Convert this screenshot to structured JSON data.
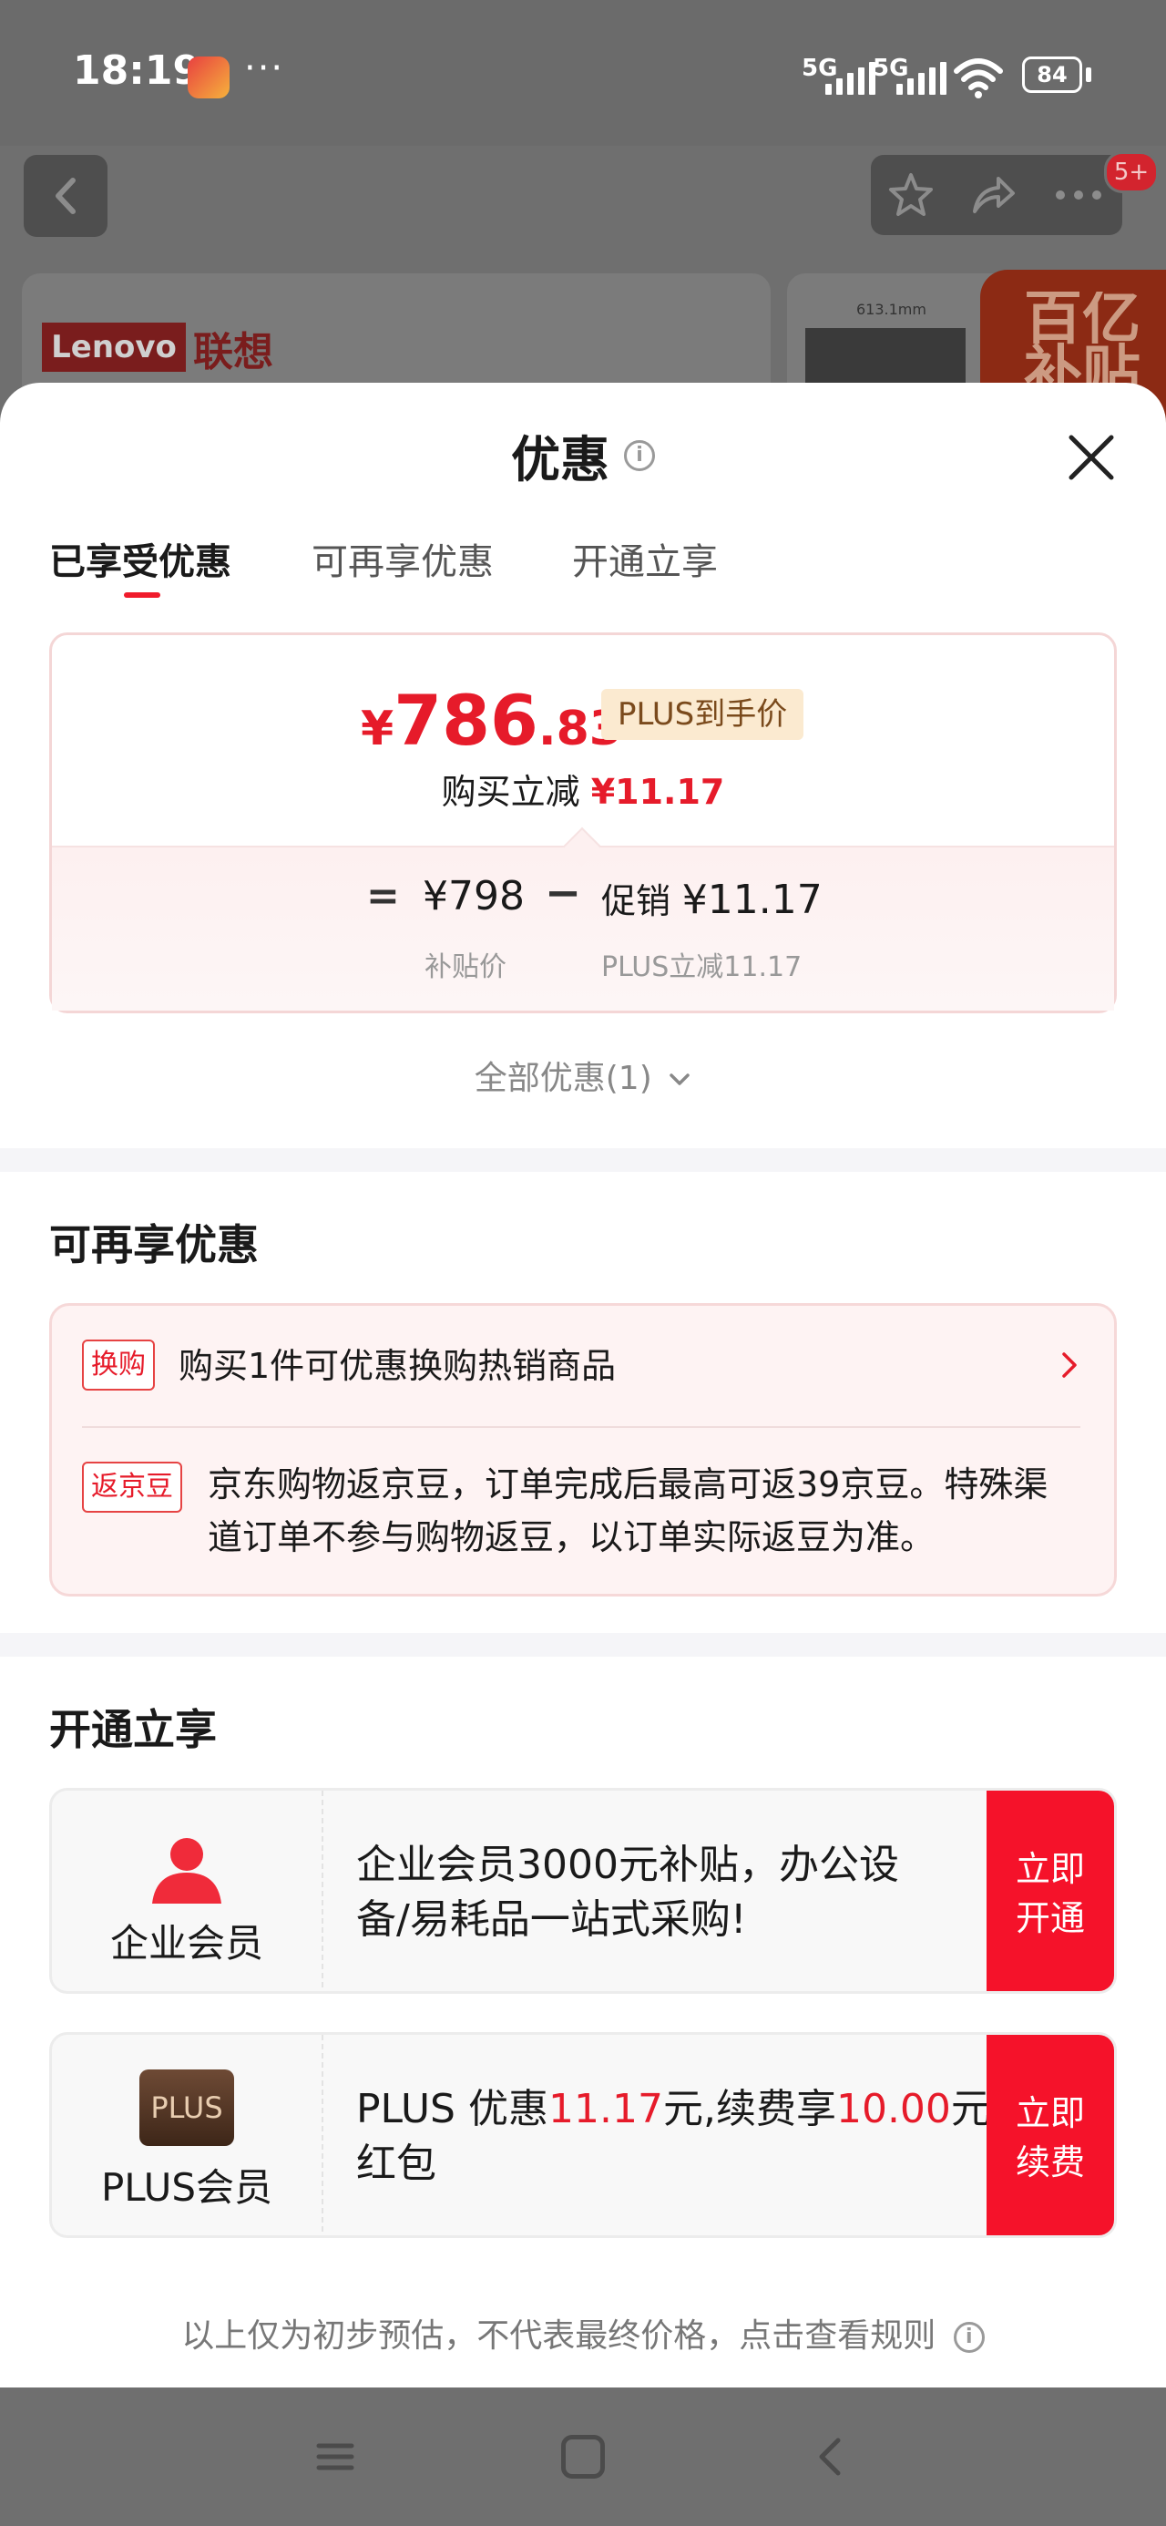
{
  "status_bar": {
    "time": "18:19",
    "signal1": "5G",
    "signal2": "5G",
    "battery": "84"
  },
  "background": {
    "cart_badge": "5+",
    "lenovo_en": "Lenovo",
    "lenovo_cn": "联想",
    "promo_text": "百亿补贴",
    "dimension_label": "613.1mm"
  },
  "sheet": {
    "title": "优惠",
    "tabs": [
      {
        "label": "已享受优惠",
        "active": true
      },
      {
        "label": "可再享优惠",
        "active": false
      },
      {
        "label": "开通立享",
        "active": false
      }
    ]
  },
  "price_card": {
    "yen": "¥",
    "final_int": "786",
    "final_dec": ".83",
    "plus_tag": "PLUS到手价",
    "reduce_label": "购买立减",
    "reduce_amount": "¥11.17",
    "eq": "=",
    "base_price": "¥798",
    "base_label": "补贴价",
    "minus": "−",
    "promo_label": "促销",
    "promo_amount": "¥11.17",
    "promo_sub": "PLUS立减11.17"
  },
  "all_promos": "全部优惠(1)",
  "extra_section": {
    "title": "可再享优惠",
    "items": [
      {
        "tag": "换购",
        "text": "购买1件可优惠换购热销商品"
      },
      {
        "tag": "返京豆",
        "text_line1": "京东购物返京豆，订单完成后最高可返39京豆。特殊渠",
        "text_line2": "道订单不参与购物返豆，以订单实际返豆为准。"
      }
    ]
  },
  "open_section": {
    "title": "开通立享",
    "cards": [
      {
        "label": "企业会员",
        "line1": "企业会员3000元补贴，办公设",
        "line2": "备/易耗品一站式采购!",
        "button": [
          "立即",
          "开通"
        ]
      },
      {
        "label": "PLUS会员",
        "logo": "PLUS",
        "prefix": "PLUS 优惠",
        "amount1": "11.17",
        "mid": "元,续费享",
        "amount2": "10.00",
        "suffix": "元",
        "line2": "红包",
        "button": [
          "立即",
          "续费"
        ]
      }
    ]
  },
  "disclaimer": "以上仅为初步预估，不代表最终价格，点击查看规则",
  "colors": {
    "accent": "#e61b2a",
    "button_red": "#f5122a",
    "plus_tag_bg": "#fbead0"
  }
}
